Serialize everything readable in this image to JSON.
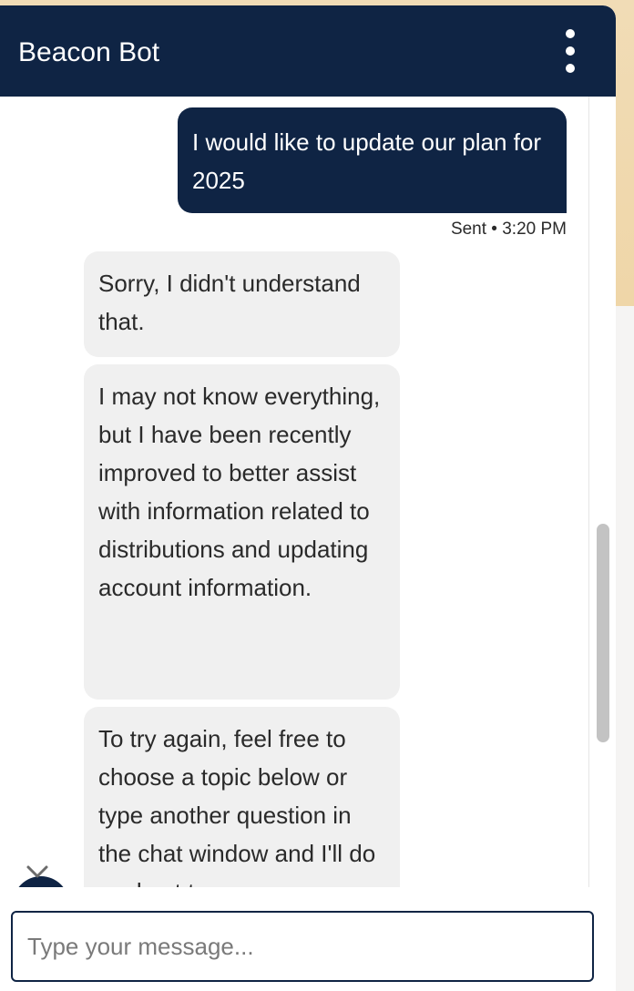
{
  "header": {
    "title": "Beacon Bot",
    "menu_icon": "more-vertical-icon"
  },
  "messages": {
    "user": {
      "text": "I would like to update our plan for 2025",
      "status": "Sent • 3:20 PM"
    },
    "bot": [
      {
        "text": "Sorry, I didn't understand that."
      },
      {
        "text": "I may not know everything, but I have been recently improved to better assist with information related to distributions and updating account information."
      },
      {
        "text": "To try again, feel free to choose a topic below or type another question in the chat window and I'll do my best to"
      }
    ]
  },
  "composer": {
    "placeholder": "Type your message..."
  },
  "colors": {
    "primary": "#0f2444",
    "bot_bubble": "#f0f0f0",
    "accent_background": "#efd6a8"
  }
}
